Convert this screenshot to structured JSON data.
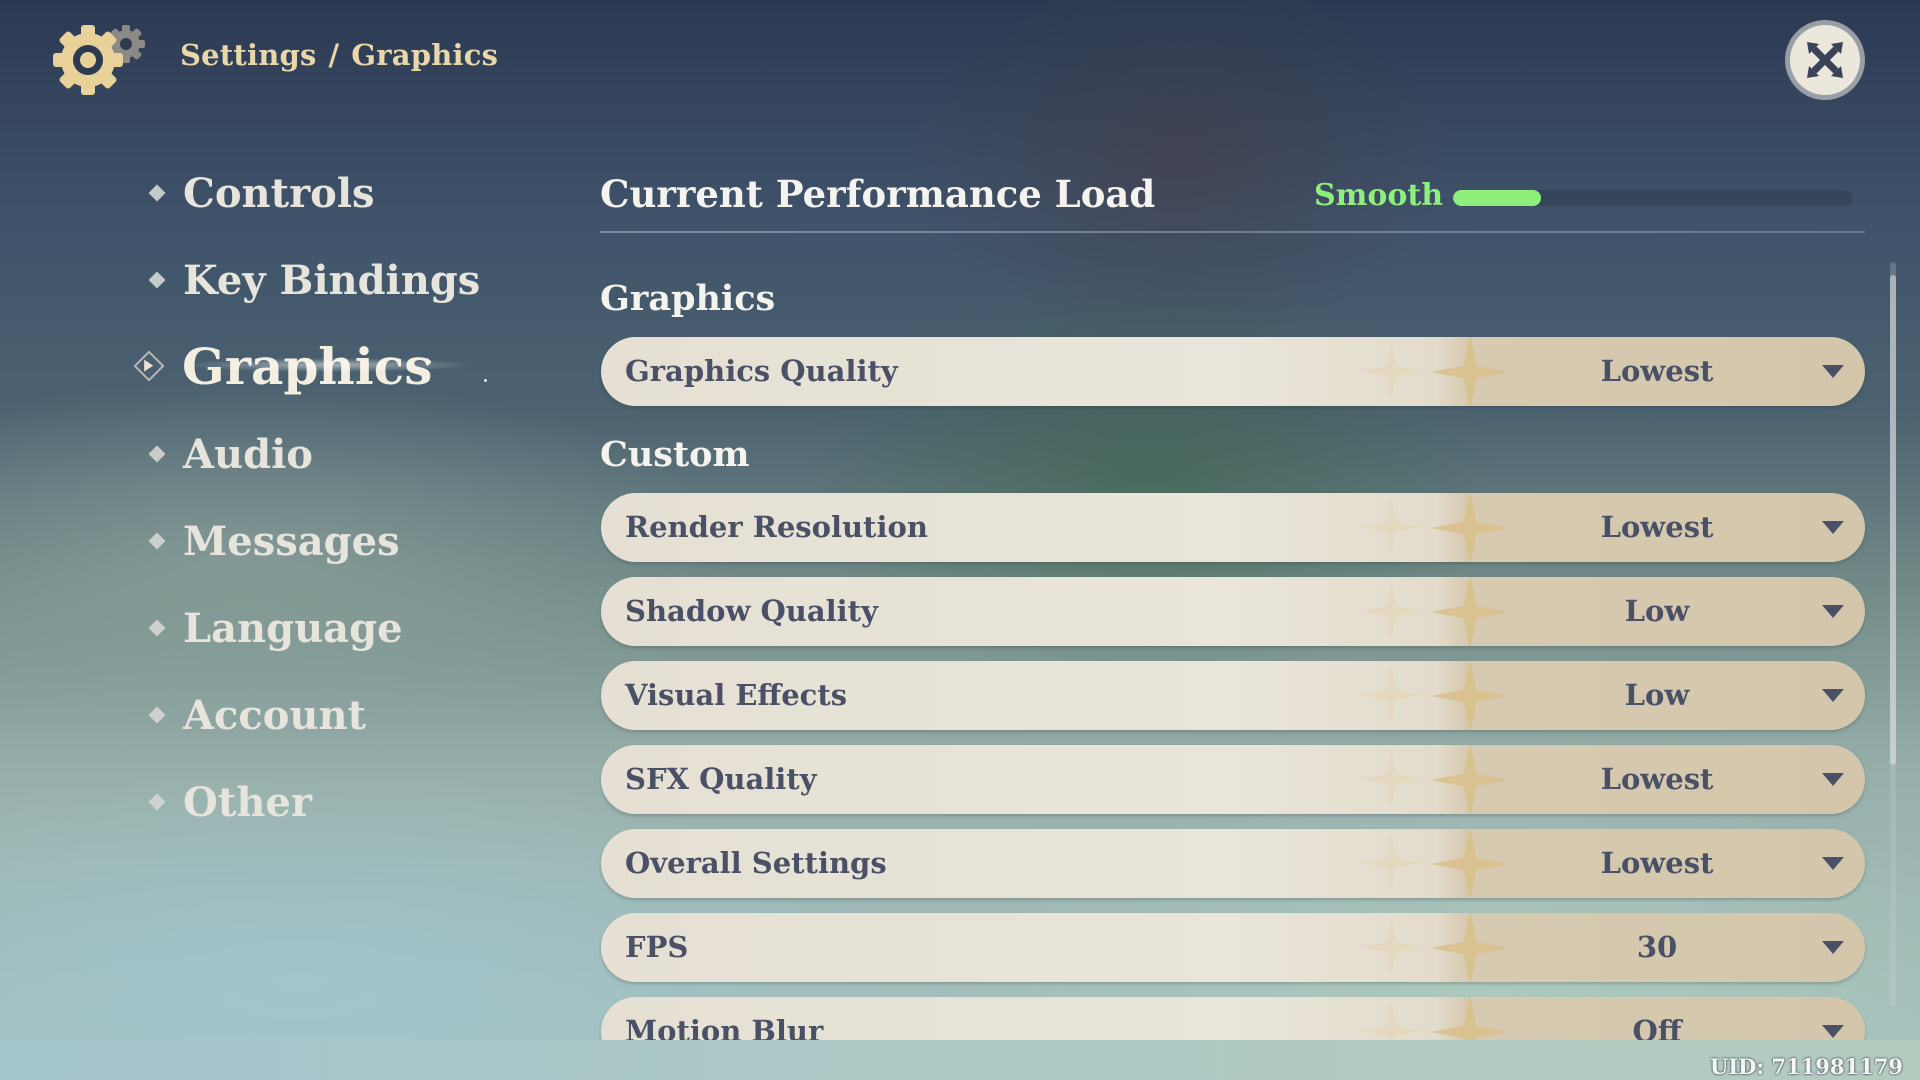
{
  "header": {
    "icon": "settings-gear-icon",
    "breadcrumb": [
      "Settings",
      "Graphics"
    ],
    "breadcrumb_separator": "/",
    "close_icon": "close-icon"
  },
  "sidebar": {
    "active_index": 2,
    "items": [
      {
        "label": "Controls"
      },
      {
        "label": "Key Bindings"
      },
      {
        "label": "Graphics"
      },
      {
        "label": "Audio"
      },
      {
        "label": "Messages"
      },
      {
        "label": "Language"
      },
      {
        "label": "Account"
      },
      {
        "label": "Other"
      }
    ]
  },
  "performance": {
    "title": "Current Performance Load",
    "status": "Smooth",
    "status_color": "#8df07a",
    "load_fraction": 0.22
  },
  "sections": {
    "graphics_heading": "Graphics",
    "custom_heading": "Custom"
  },
  "graphics_quality": {
    "label": "Graphics Quality",
    "value": "Lowest"
  },
  "custom_settings": [
    {
      "label": "Render Resolution",
      "value": "Lowest"
    },
    {
      "label": "Shadow Quality",
      "value": "Low"
    },
    {
      "label": "Visual Effects",
      "value": "Low"
    },
    {
      "label": "SFX Quality",
      "value": "Lowest"
    },
    {
      "label": "Overall Settings",
      "value": "Lowest"
    },
    {
      "label": "FPS",
      "value": "30"
    },
    {
      "label": "Motion Blur",
      "value": "Off"
    }
  ],
  "footer": {
    "uid": "UID: 711981179"
  },
  "colors": {
    "accent_gold": "#e9d7a9",
    "row_text": "#4a5167",
    "row_background": "#e5e0d3",
    "row_value_background": "#d3c6ab"
  }
}
